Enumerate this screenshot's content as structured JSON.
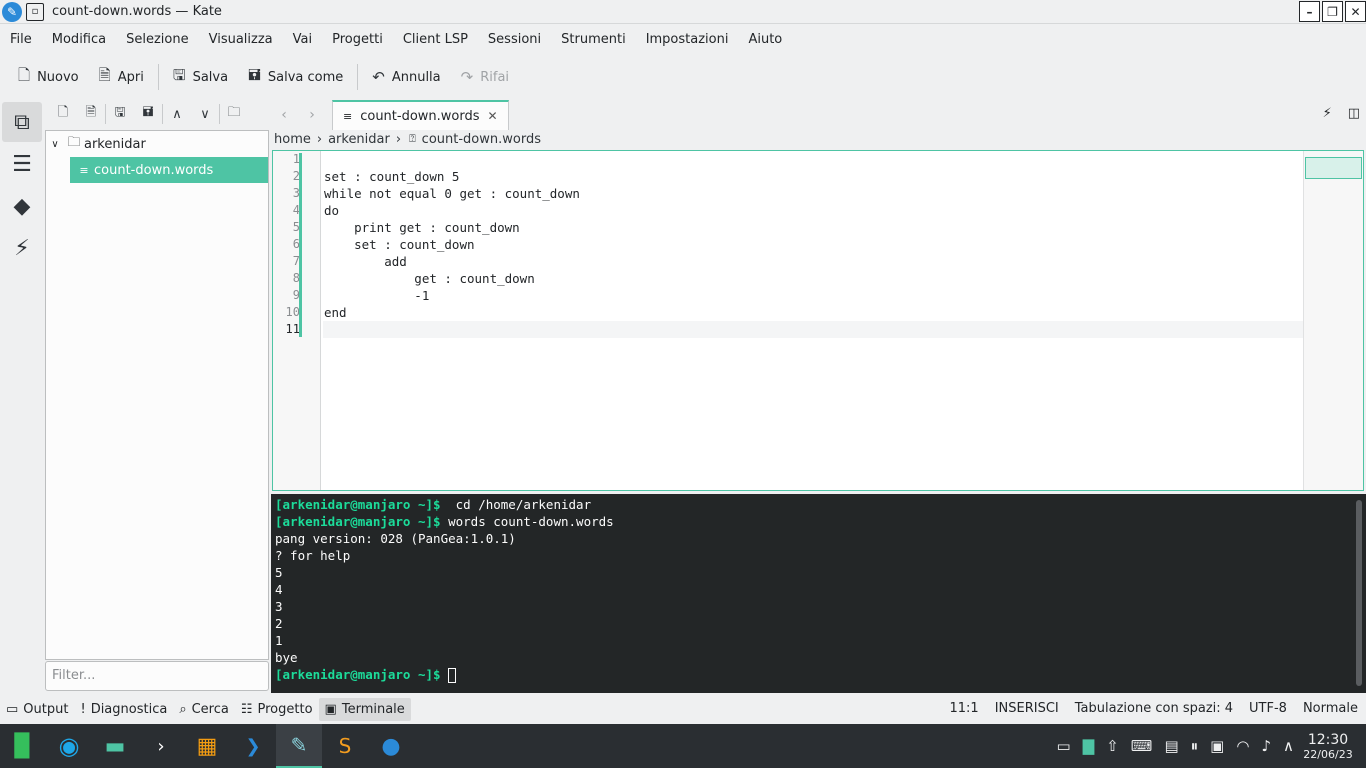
{
  "window": {
    "title": "count-down.words — Kate"
  },
  "menu": [
    "File",
    "Modifica",
    "Selezione",
    "Visualizza",
    "Vai",
    "Progetti",
    "Client LSP",
    "Sessioni",
    "Strumenti",
    "Impostazioni",
    "Aiuto"
  ],
  "toolbar": {
    "new": "Nuovo",
    "open": "Apri",
    "save": "Salva",
    "save_as": "Salva come",
    "undo": "Annulla",
    "redo": "Rifai"
  },
  "filetree": {
    "folder": "arkenidar",
    "file": "count-down.words",
    "filter_placeholder": "Filter..."
  },
  "tab": {
    "label": "count-down.words"
  },
  "breadcrumb": {
    "home": "home",
    "user": "arkenidar",
    "file": "count-down.words"
  },
  "code": {
    "lines": [
      "",
      "set : count_down 5",
      "while not equal 0 get : count_down",
      "do",
      "    print get : count_down",
      "    set : count_down",
      "        add",
      "            get : count_down",
      "            -1",
      "end",
      ""
    ],
    "numbers": [
      "1",
      "2",
      "3",
      "4",
      "5",
      "6",
      "7",
      "8",
      "9",
      "10",
      "11"
    ]
  },
  "terminal": {
    "prompt": "[arkenidar@manjaro ~]$",
    "line1_cmd": "  cd /home/arkenidar",
    "line2_cmd": " words count-down.words",
    "output": [
      "pang version: 028 (PanGea:1.0.1)",
      "? for help",
      "5",
      "4",
      "3",
      "2",
      "1",
      "bye"
    ],
    "last_cmd": " "
  },
  "statusbar": {
    "output": "Output",
    "diagnostics": "Diagnostica",
    "search": "Cerca",
    "project": "Progetto",
    "terminal": "Terminale",
    "position": "11:1",
    "mode": "INSERISCI",
    "indent": "Tabulazione con spazi: 4",
    "encoding": "UTF-8",
    "eol": "Normale"
  },
  "clock": {
    "time": "12:30",
    "date": "22/06/23"
  },
  "colors": {
    "accent": "#4ec4a4",
    "terminal_bg": "#232627",
    "prompt": "#1cdc9a",
    "taskbar": "#2a2e32"
  }
}
